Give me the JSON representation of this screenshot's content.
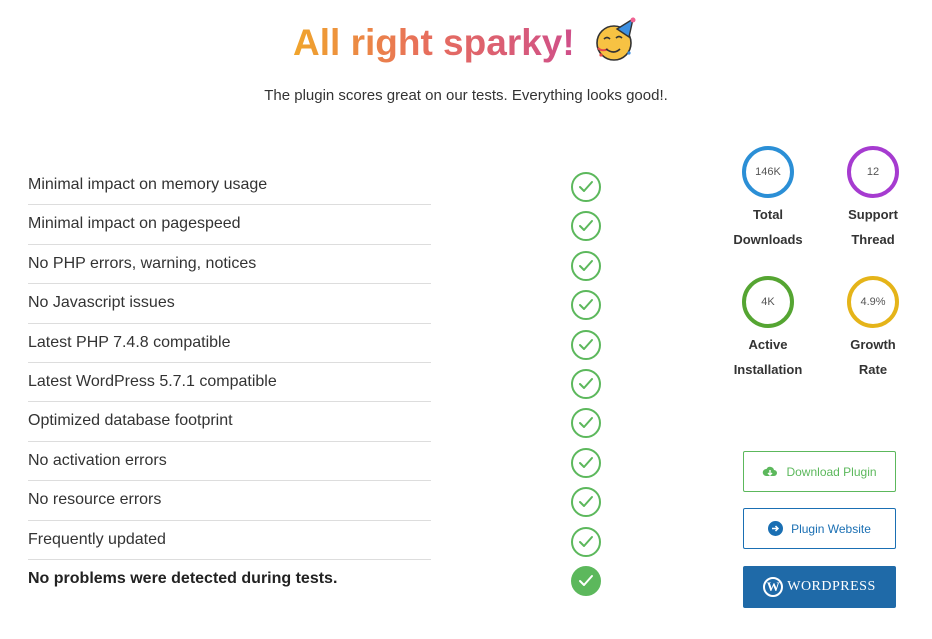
{
  "header": {
    "title": "All right sparky!",
    "emoji_icon": "party-face-icon",
    "subtitle": "The plugin scores great on our tests. Everything looks good!."
  },
  "checks": [
    {
      "label": "Minimal impact on memory usage",
      "passed": true
    },
    {
      "label": "Minimal impact on pagespeed",
      "passed": true
    },
    {
      "label": "No PHP errors, warning, notices",
      "passed": true
    },
    {
      "label": "No Javascript issues",
      "passed": true
    },
    {
      "label": "Latest PHP 7.4.8 compatible",
      "passed": true
    },
    {
      "label": "Latest WordPress 5.7.1 compatible",
      "passed": true
    },
    {
      "label": "Optimized database footprint",
      "passed": true
    },
    {
      "label": "No activation errors",
      "passed": true
    },
    {
      "label": "No resource errors",
      "passed": true
    },
    {
      "label": "Frequently updated",
      "passed": true
    },
    {
      "label": "No problems were detected during tests.",
      "passed": true,
      "summary": true
    }
  ],
  "stats": {
    "downloads": {
      "value": "146K",
      "label_line1": "Total",
      "label_line2": "Downloads",
      "color": "#2b8fd6"
    },
    "support": {
      "value": "12",
      "label_line1": "Support",
      "label_line2": "Thread",
      "color": "#a63bd0"
    },
    "active": {
      "value": "4K",
      "label_line1": "Active",
      "label_line2": "Installation",
      "color": "#55a532"
    },
    "growth": {
      "value": "4.9%",
      "label_line1": "Growth",
      "label_line2": "Rate",
      "color": "#e5b419"
    }
  },
  "buttons": {
    "download": "Download Plugin",
    "website": "Plugin Website",
    "wordpress": "WordPress"
  },
  "colors": {
    "check_green": "#5cb85c",
    "wp_blue": "#1f6aa8",
    "website_blue": "#1a6fb3"
  }
}
